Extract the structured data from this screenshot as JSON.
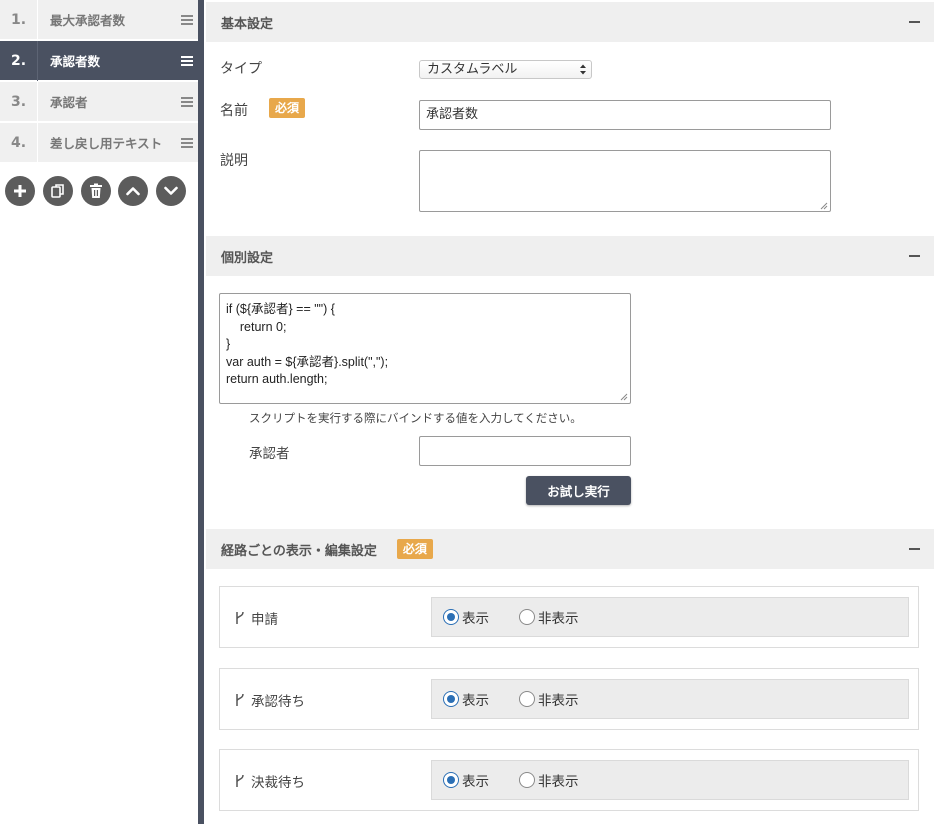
{
  "sidebar": {
    "items": [
      {
        "num": "1.",
        "label": "最大承認者数"
      },
      {
        "num": "2.",
        "label": "承認者数"
      },
      {
        "num": "3.",
        "label": "承認者"
      },
      {
        "num": "4.",
        "label": "差し戻し用テキスト"
      }
    ],
    "active_index": 1,
    "toolbar_icons": [
      "add-icon",
      "copy-icon",
      "trash-icon",
      "chevron-up-icon",
      "chevron-down-icon"
    ]
  },
  "basic": {
    "title": "基本設定",
    "type_label": "タイプ",
    "type_value": "カスタムラベル",
    "name_label": "名前",
    "required_badge": "必須",
    "name_value": "承認者数",
    "desc_label": "説明",
    "desc_value": ""
  },
  "individual": {
    "title": "個別設定",
    "script": "if (${承認者} == \"\") {\n    return 0;\n}\nvar auth = ${承認者}.split(\",\");\nreturn auth.length;",
    "hint": "スクリプトを実行する際にバインドする値を入力してください。",
    "bind_label": "承認者",
    "bind_value": "",
    "run_button": "お試し実行"
  },
  "routes": {
    "title": "経路ごとの表示・編集設定",
    "required_badge": "必須",
    "show_label": "表示",
    "hide_label": "非表示",
    "items": [
      {
        "name": "申請",
        "selected": "表示"
      },
      {
        "name": "承認待ち",
        "selected": "表示"
      },
      {
        "name": "決裁待ち",
        "selected": "表示"
      }
    ]
  },
  "colors": {
    "active_nav": "#4a5161",
    "badge": "#e8a84b",
    "radio_selected": "#2b6fb5"
  }
}
